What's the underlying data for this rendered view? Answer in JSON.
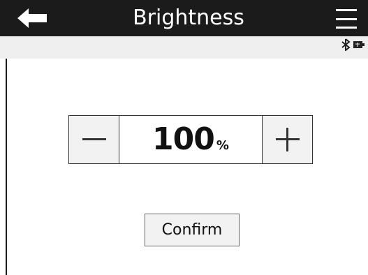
{
  "header": {
    "title": "Brightness",
    "back_icon": "arrow-left-icon",
    "menu_icon": "hamburger-menu-icon"
  },
  "status": {
    "icons": [
      "bluetooth-icon",
      "battery-icon"
    ]
  },
  "brightness": {
    "value": "100",
    "unit": "%",
    "decrease_icon": "minus-icon",
    "increase_icon": "plus-icon"
  },
  "actions": {
    "confirm_label": "Confirm"
  },
  "colors": {
    "header_bg": "#1b1b1b",
    "header_text": "#ffffff",
    "status_bg": "#efefef",
    "control_bg": "#f2f2f2",
    "border": "#333333",
    "text": "#111111"
  }
}
